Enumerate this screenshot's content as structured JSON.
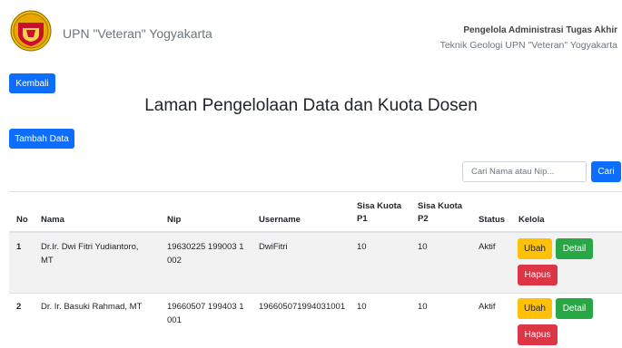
{
  "header": {
    "brand": "UPN \"Veteran\" Yogyakarta",
    "role": "Pengelola Administrasi Tugas Akhir",
    "department": "Teknik Geologi UPN \"Veteran\" Yogyakarta"
  },
  "back_button": "Kembali",
  "page_title": "Laman Pengelolaan Data dan Kuota Dosen",
  "add_button": "Tambah Data",
  "search": {
    "placeholder": "Cari Nama atau Nip...",
    "button": "Cari"
  },
  "table": {
    "headers": {
      "no": "No",
      "nama": "Nama",
      "nip": "Nip",
      "username": "Username",
      "p1_l1": "Sisa Kuota",
      "p1_l2": "P1",
      "p2_l1": "Sisa Kuota",
      "p2_l2": "P2",
      "status": "Status",
      "kelola": "Kelola"
    },
    "rows": [
      {
        "no": "1",
        "nama_l1": "Dr.Ir. Dwi Fitri Yudiantoro,",
        "nama_l2": "MT",
        "nip_l1": "19630225 199003 1",
        "nip_l2": "002",
        "username": "DwiFitri",
        "p1": "10",
        "p2": "10",
        "status": "Aktif",
        "actions": {
          "edit": "Ubah",
          "detail": "Detail",
          "delete": "Hapus"
        }
      },
      {
        "no": "2",
        "nama_l1": "Dr. Ir. Basuki Rahmad, MT",
        "nama_l2": "",
        "nip_l1": "19660507 199403 1",
        "nip_l2": "001",
        "username": "196605071994031001",
        "p1": "10",
        "p2": "10",
        "status": "Aktif",
        "actions": {
          "edit": "Ubah",
          "detail": "Detail",
          "delete": "Hapus"
        }
      }
    ]
  },
  "colors": {
    "primary": "#0d6efd",
    "warning": "#ffc107",
    "success": "#28a745",
    "danger": "#dc3545",
    "stripe": "#f2f2f2"
  }
}
